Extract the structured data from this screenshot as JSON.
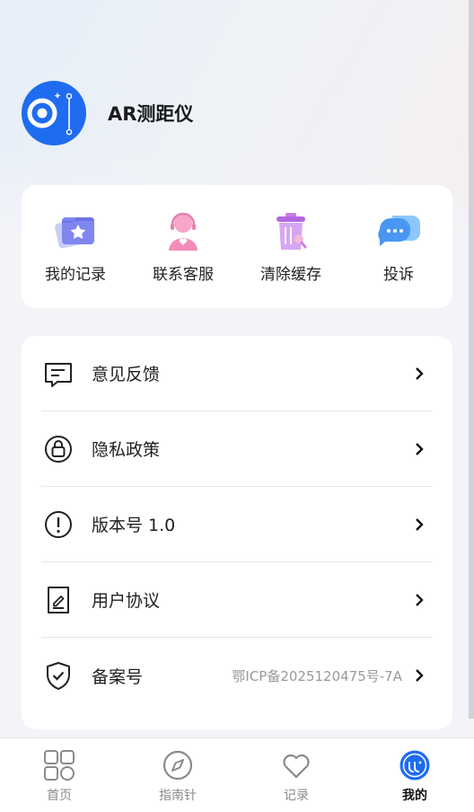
{
  "app": {
    "name": "AR测距仪",
    "logo_icon": "ar-measure-logo-icon",
    "brand_color": "#1f6cf0"
  },
  "quick_actions": [
    {
      "label": "我的记录",
      "icon": "records-folder-icon"
    },
    {
      "label": "联系客服",
      "icon": "customer-service-icon"
    },
    {
      "label": "清除缓存",
      "icon": "trash-icon"
    },
    {
      "label": "投诉",
      "icon": "chat-bubble-icon"
    }
  ],
  "menu": [
    {
      "label": "意见反馈",
      "icon": "feedback-icon",
      "value": ""
    },
    {
      "label": "隐私政策",
      "icon": "lock-icon",
      "value": ""
    },
    {
      "label": "版本号 1.0",
      "icon": "info-icon",
      "value": ""
    },
    {
      "label": "用户协议",
      "icon": "agreement-icon",
      "value": ""
    },
    {
      "label": "备案号",
      "icon": "shield-check-icon",
      "value": "鄂ICP备2025120475号-7A"
    }
  ],
  "tabs": [
    {
      "label": "首页",
      "icon": "grid-icon",
      "active": false
    },
    {
      "label": "指南针",
      "icon": "compass-icon",
      "active": false
    },
    {
      "label": "记录",
      "icon": "heart-icon",
      "active": false
    },
    {
      "label": "我的",
      "icon": "profile-icon",
      "active": true
    }
  ]
}
